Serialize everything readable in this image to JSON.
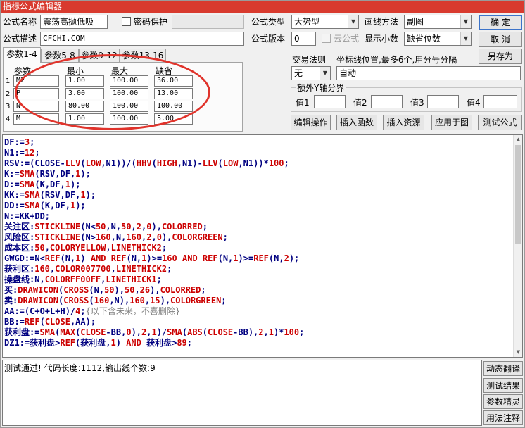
{
  "window": {
    "title": "指标公式编辑器"
  },
  "form": {
    "name_label": "公式名称",
    "name_value": "震荡高抛低吸",
    "password_label": "密码保护",
    "type_label": "公式类型",
    "type_value": "大势型",
    "draw_label": "画线方法",
    "draw_value": "副图",
    "desc_label": "公式描述",
    "desc_value": "CFCHI.COM",
    "version_label": "公式版本",
    "version_value": "0",
    "cloud_label": "云公式",
    "decimals_label": "显示小数",
    "decimals_value": "缺省位数"
  },
  "buttons": {
    "ok": "确  定",
    "cancel": "取  消",
    "save_as": "另存为",
    "edit_ops": "编辑操作",
    "insert_func": "插入函数",
    "insert_res": "插入资源",
    "apply_chart": "应用于图",
    "test_formula": "测试公式",
    "dyn_translate": "动态翻译",
    "test_result": "测试结果",
    "param_wizard": "参数精灵",
    "usage_notes": "用法注释"
  },
  "tabs": [
    "参数1-4",
    "参数5-8",
    "参数9-12",
    "参数13-16"
  ],
  "params": {
    "headers": {
      "name": "参数",
      "min": "最小",
      "max": "最大",
      "default": "缺省"
    },
    "rows": [
      {
        "num": "1",
        "name": "M2",
        "min": "1.00",
        "max": "100.00",
        "default": "36.00"
      },
      {
        "num": "2",
        "name": "P",
        "min": "3.00",
        "max": "100.00",
        "default": "13.00"
      },
      {
        "num": "3",
        "name": "N",
        "min": "80.00",
        "max": "100.00",
        "default": "100.00"
      },
      {
        "num": "4",
        "name": "M",
        "min": "1.00",
        "max": "100.00",
        "default": "5.00"
      }
    ]
  },
  "trade": {
    "rule_label": "交易法则",
    "rule_value": "无",
    "coord_label": "坐标线位置,最多6个,用分号分隔",
    "coord_value": "自动",
    "extra_axis_label": "额外Y轴分界",
    "val_labels": [
      "值1",
      "值2",
      "值3",
      "值4"
    ]
  },
  "code_lines": [
    [
      [
        "DF:=",
        "#000080"
      ],
      [
        "3",
        "#cc0000"
      ],
      [
        ";",
        "#000080"
      ]
    ],
    [
      [
        "N1:=",
        "#000080"
      ],
      [
        "12",
        "#cc0000"
      ],
      [
        ";",
        "#000080"
      ]
    ],
    [
      [
        "RSV:=(CLOSE-",
        "#000080"
      ],
      [
        "LLV",
        "#cc0000"
      ],
      [
        "(",
        "#000080"
      ],
      [
        "LOW",
        "#cc0000"
      ],
      [
        ",N1))/(",
        "#000080"
      ],
      [
        "HHV",
        "#cc0000"
      ],
      [
        "(",
        "#000080"
      ],
      [
        "HIGH",
        "#cc0000"
      ],
      [
        ",N1)-",
        "#000080"
      ],
      [
        "LLV",
        "#cc0000"
      ],
      [
        "(",
        "#000080"
      ],
      [
        "LOW",
        "#cc0000"
      ],
      [
        ",N1))*",
        "#000080"
      ],
      [
        "100",
        "#cc0000"
      ],
      [
        ";",
        "#000080"
      ]
    ],
    [
      [
        "K:=",
        "#000080"
      ],
      [
        "SMA",
        "#cc0000"
      ],
      [
        "(RSV,DF,",
        "#000080"
      ],
      [
        "1",
        "#cc0000"
      ],
      [
        ");",
        "#000080"
      ]
    ],
    [
      [
        "D:=",
        "#000080"
      ],
      [
        "SMA",
        "#cc0000"
      ],
      [
        "(K,DF,",
        "#000080"
      ],
      [
        "1",
        "#cc0000"
      ],
      [
        ");",
        "#000080"
      ]
    ],
    [
      [
        "KK:=",
        "#000080"
      ],
      [
        "SMA",
        "#cc0000"
      ],
      [
        "(RSV,DF,",
        "#000080"
      ],
      [
        "1",
        "#cc0000"
      ],
      [
        ");",
        "#000080"
      ]
    ],
    [
      [
        "DD:=",
        "#000080"
      ],
      [
        "SMA",
        "#cc0000"
      ],
      [
        "(K,DF,",
        "#000080"
      ],
      [
        "1",
        "#cc0000"
      ],
      [
        ");",
        "#000080"
      ]
    ],
    [
      [
        "N:=KK+DD;",
        "#000080"
      ]
    ],
    [
      [
        "关注区:",
        "#000080"
      ],
      [
        "STICKLINE",
        "#cc0000"
      ],
      [
        "(N<",
        "#000080"
      ],
      [
        "50",
        "#cc0000"
      ],
      [
        ",N,",
        "#000080"
      ],
      [
        "50",
        "#cc0000"
      ],
      [
        ",",
        "#000080"
      ],
      [
        "2",
        "#cc0000"
      ],
      [
        ",",
        "#000080"
      ],
      [
        "0",
        "#cc0000"
      ],
      [
        "),",
        "#000080"
      ],
      [
        "COLORRED",
        "#cc0000"
      ],
      [
        ";",
        "#000080"
      ]
    ],
    [
      [
        "风险区:",
        "#000080"
      ],
      [
        "STICKLINE",
        "#cc0000"
      ],
      [
        "(N>",
        "#000080"
      ],
      [
        "160",
        "#cc0000"
      ],
      [
        ",N,",
        "#000080"
      ],
      [
        "160",
        "#cc0000"
      ],
      [
        ",",
        "#000080"
      ],
      [
        "2",
        "#cc0000"
      ],
      [
        ",",
        "#000080"
      ],
      [
        "0",
        "#cc0000"
      ],
      [
        "),",
        "#000080"
      ],
      [
        "COLORGREEN",
        "#cc0000"
      ],
      [
        ";",
        "#000080"
      ]
    ],
    [
      [
        "成本区:",
        "#000080"
      ],
      [
        "50",
        "#cc0000"
      ],
      [
        ",",
        "#000080"
      ],
      [
        "COLORYELLOW",
        "#cc0000"
      ],
      [
        ",",
        "#000080"
      ],
      [
        "LINETHICK2",
        "#cc0000"
      ],
      [
        ";",
        "#000080"
      ]
    ],
    [
      [
        "GWGD:=N<",
        "#000080"
      ],
      [
        "REF",
        "#cc0000"
      ],
      [
        "(N,",
        "#000080"
      ],
      [
        "1",
        "#cc0000"
      ],
      [
        ") ",
        "#000080"
      ],
      [
        "AND",
        "#cc0000"
      ],
      [
        " ",
        "#000080"
      ],
      [
        "REF",
        "#cc0000"
      ],
      [
        "(N,",
        "#000080"
      ],
      [
        "1",
        "#cc0000"
      ],
      [
        ")>=",
        "#000080"
      ],
      [
        "160",
        "#cc0000"
      ],
      [
        " ",
        "#000080"
      ],
      [
        "AND",
        "#cc0000"
      ],
      [
        " ",
        "#000080"
      ],
      [
        "REF",
        "#cc0000"
      ],
      [
        "(N,",
        "#000080"
      ],
      [
        "1",
        "#cc0000"
      ],
      [
        ")>=",
        "#000080"
      ],
      [
        "REF",
        "#cc0000"
      ],
      [
        "(N,",
        "#000080"
      ],
      [
        "2",
        "#cc0000"
      ],
      [
        ");",
        "#000080"
      ]
    ],
    [
      [
        "获利区:",
        "#000080"
      ],
      [
        "160",
        "#cc0000"
      ],
      [
        ",",
        "#000080"
      ],
      [
        "COLOR007700",
        "#cc0000"
      ],
      [
        ",",
        "#000080"
      ],
      [
        "LINETHICK2",
        "#cc0000"
      ],
      [
        ";",
        "#000080"
      ]
    ],
    [
      [
        "操盘线:N,",
        "#000080"
      ],
      [
        "COLORFF00FF",
        "#cc0000"
      ],
      [
        ",",
        "#000080"
      ],
      [
        "LINETHICK1",
        "#cc0000"
      ],
      [
        ";",
        "#000080"
      ]
    ],
    [
      [
        "买:",
        "#000080"
      ],
      [
        "DRAWICON",
        "#cc0000"
      ],
      [
        "(",
        "#000080"
      ],
      [
        "CROSS",
        "#cc0000"
      ],
      [
        "(N,",
        "#000080"
      ],
      [
        "50",
        "#cc0000"
      ],
      [
        "),",
        "#000080"
      ],
      [
        "50",
        "#cc0000"
      ],
      [
        ",",
        "#000080"
      ],
      [
        "26",
        "#cc0000"
      ],
      [
        "),",
        "#000080"
      ],
      [
        "COLORRED",
        "#cc0000"
      ],
      [
        ";",
        "#000080"
      ]
    ],
    [
      [
        "卖:",
        "#000080"
      ],
      [
        "DRAWICON",
        "#cc0000"
      ],
      [
        "(",
        "#000080"
      ],
      [
        "CROSS",
        "#cc0000"
      ],
      [
        "(",
        "#000080"
      ],
      [
        "160",
        "#cc0000"
      ],
      [
        ",N),",
        "#000080"
      ],
      [
        "160",
        "#cc0000"
      ],
      [
        ",",
        "#000080"
      ],
      [
        "15",
        "#cc0000"
      ],
      [
        "),",
        "#000080"
      ],
      [
        "COLORGREEN",
        "#cc0000"
      ],
      [
        ";",
        "#000080"
      ]
    ],
    [
      [
        "AA:=(C+O+L+H)/",
        "#000080"
      ],
      [
        "4",
        "#cc0000"
      ],
      [
        ";",
        "#000080"
      ],
      [
        "{以下含未来，不喜删除}",
        "#808080"
      ]
    ],
    [
      [
        "BB:=",
        "#000080"
      ],
      [
        "REF",
        "#cc0000"
      ],
      [
        "(",
        "#000080"
      ],
      [
        "CLOSE",
        "#cc0000"
      ],
      [
        ",AA);",
        "#000080"
      ]
    ],
    [
      [
        "获利盘:=",
        "#000080"
      ],
      [
        "SMA",
        "#cc0000"
      ],
      [
        "(",
        "#000080"
      ],
      [
        "MAX",
        "#cc0000"
      ],
      [
        "(",
        "#000080"
      ],
      [
        "CLOSE",
        "#cc0000"
      ],
      [
        "-BB,",
        "#000080"
      ],
      [
        "0",
        "#cc0000"
      ],
      [
        "),",
        "#000080"
      ],
      [
        "2",
        "#cc0000"
      ],
      [
        ",",
        "#000080"
      ],
      [
        "1",
        "#cc0000"
      ],
      [
        ")/",
        "#000080"
      ],
      [
        "SMA",
        "#cc0000"
      ],
      [
        "(",
        "#000080"
      ],
      [
        "ABS",
        "#cc0000"
      ],
      [
        "(",
        "#000080"
      ],
      [
        "CLOSE",
        "#cc0000"
      ],
      [
        "-BB),",
        "#000080"
      ],
      [
        "2",
        "#cc0000"
      ],
      [
        ",",
        "#000080"
      ],
      [
        "1",
        "#cc0000"
      ],
      [
        ")*",
        "#000080"
      ],
      [
        "100",
        "#cc0000"
      ],
      [
        ";",
        "#000080"
      ]
    ],
    [
      [
        "DZ1:=获利盘>",
        "#000080"
      ],
      [
        "REF",
        "#cc0000"
      ],
      [
        "(获利盘,",
        "#000080"
      ],
      [
        "1",
        "#cc0000"
      ],
      [
        ") ",
        "#000080"
      ],
      [
        "AND",
        "#cc0000"
      ],
      [
        " 获利盘>",
        "#000080"
      ],
      [
        "89",
        "#cc0000"
      ],
      [
        ";",
        "#000080"
      ]
    ]
  ],
  "status_text": "测试通过! 代码长度:1112,输出线个数:9",
  "colors": {
    "title_bg": "#d83a2e",
    "highlight_ellipse": "#e0332b"
  }
}
